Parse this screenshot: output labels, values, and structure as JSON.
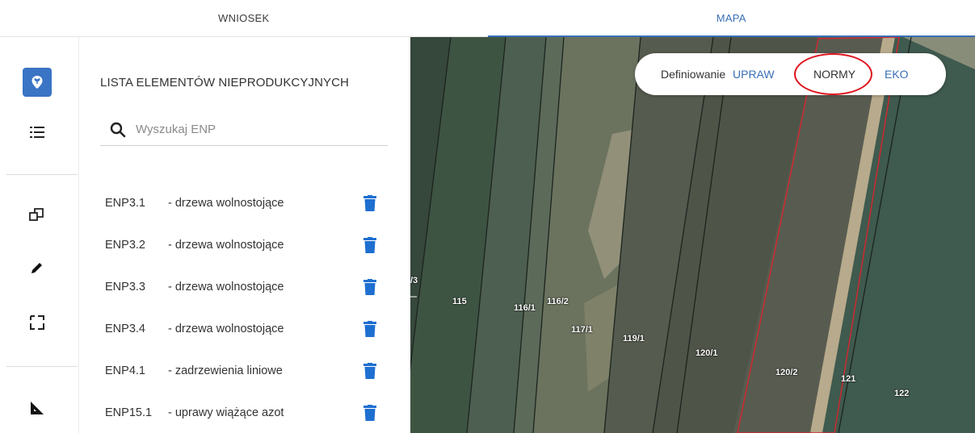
{
  "tabs": [
    {
      "label": "WNIOSEK",
      "active": false
    },
    {
      "label": "MAPA",
      "active": true
    }
  ],
  "colors": {
    "accent": "#3a74c4",
    "trash": "#1e6fd0",
    "highlight": "#e0141e"
  },
  "rail": {
    "items": [
      {
        "icon": "plant-pin-icon",
        "active": true
      },
      {
        "icon": "list-icon",
        "active": false
      },
      {
        "icon": "copy-icon",
        "active": false
      },
      {
        "icon": "pencil-icon",
        "active": false
      },
      {
        "icon": "select-rectangle-icon",
        "active": false
      },
      {
        "icon": "set-square-icon",
        "active": false
      }
    ]
  },
  "panel": {
    "title": "LISTA ELEMENTÓW NIEPRODUKCYJNYCH",
    "search_placeholder": "Wyszukaj ENP",
    "items": [
      {
        "code": "ENP3.1",
        "desc": "- drzewa wolnostojące"
      },
      {
        "code": "ENP3.2",
        "desc": "- drzewa wolnostojące"
      },
      {
        "code": "ENP3.3",
        "desc": "- drzewa wolnostojące"
      },
      {
        "code": "ENP3.4",
        "desc": "- drzewa wolnostojące"
      },
      {
        "code": "ENP4.1",
        "desc": "- zadrzewienia liniowe"
      },
      {
        "code": "ENP15.1",
        "desc": "- uprawy wiążące azot"
      }
    ]
  },
  "definition": {
    "label": "Definiowanie",
    "options": [
      {
        "label": "UPRAW",
        "selected": false
      },
      {
        "label": "NORMY",
        "selected": true
      },
      {
        "label": "EKO",
        "selected": false
      }
    ]
  },
  "map": {
    "parcels": [
      "/3",
      "115",
      "116/1",
      "116/2",
      "117/1",
      "119/1",
      "120/1",
      "120/2",
      "121",
      "122"
    ]
  }
}
